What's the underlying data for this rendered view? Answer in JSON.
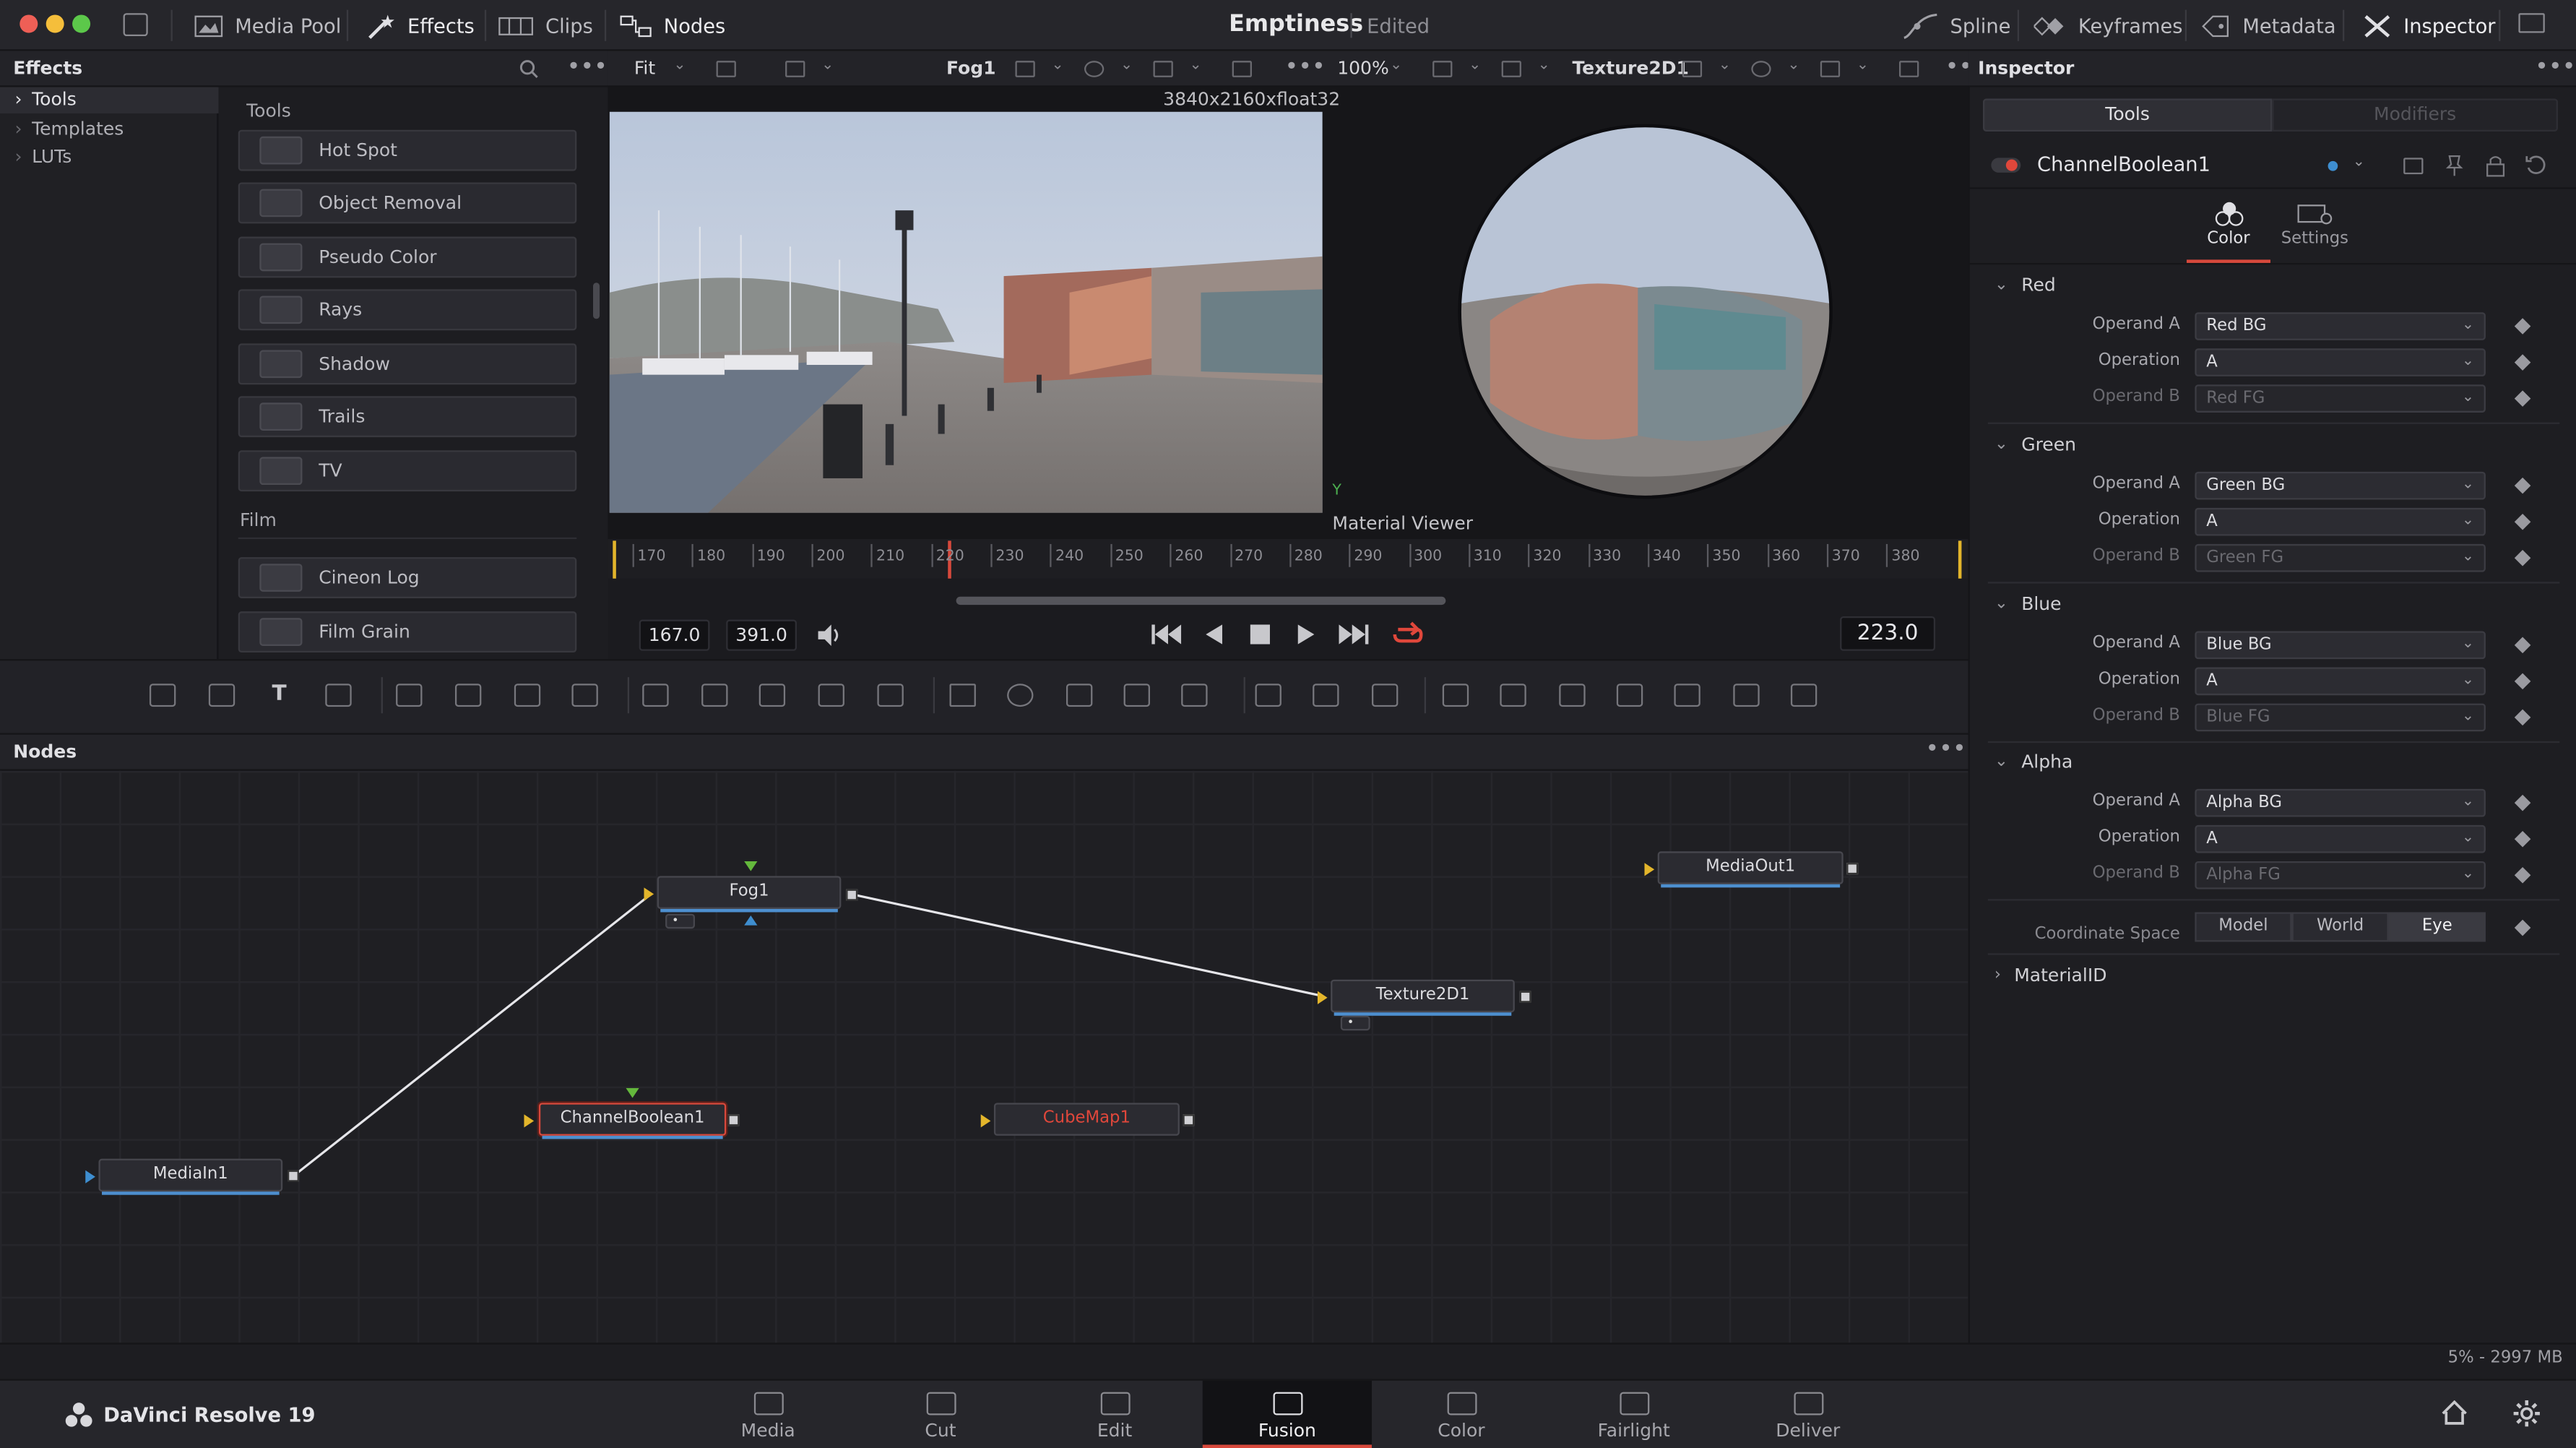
{
  "topbar": {
    "media_pool": "Media Pool",
    "effects": "Effects",
    "clips": "Clips",
    "nodes": "Nodes",
    "project": "Emptiness",
    "status": "Edited",
    "spline": "Spline",
    "keyframes": "Keyframes",
    "metadata": "Metadata",
    "inspector": "Inspector"
  },
  "effects_panel": {
    "title": "Effects",
    "tree": [
      {
        "label": "Tools"
      },
      {
        "label": "Templates"
      },
      {
        "label": "LUTs"
      }
    ],
    "section_tools": "Tools",
    "tools": [
      "Hot Spot",
      "Object Removal",
      "Pseudo Color",
      "Rays",
      "Shadow",
      "Trails",
      "TV"
    ],
    "section_film": "Film",
    "film_tools": [
      "Cineon Log",
      "Film Grain"
    ]
  },
  "viewer_left": {
    "fit": "Fit",
    "node": "Fog1",
    "resolution": "3840x2160xfloat32"
  },
  "viewer_right": {
    "zoom": "100%",
    "node": "Texture2D1",
    "caption": "Material Viewer",
    "axis_y": "Y"
  },
  "timeline": {
    "ticks": [
      "170",
      "180",
      "190",
      "200",
      "210",
      "220",
      "230",
      "240",
      "250",
      "260",
      "270",
      "280",
      "290",
      "300",
      "310",
      "320",
      "330",
      "340",
      "350",
      "360",
      "370",
      "380"
    ],
    "start": "167.0",
    "end": "391.0",
    "current": "223.0"
  },
  "nodes_panel": {
    "title": "Nodes",
    "nodes": {
      "fog": "Fog1",
      "mediaout": "MediaOut1",
      "texture": "Texture2D1",
      "channelboolean": "ChannelBoolean1",
      "cubemap": "CubeMap1",
      "mediain": "MediaIn1"
    },
    "memory": "5% - 2997 MB"
  },
  "inspector": {
    "title": "Inspector",
    "tab_tools": "Tools",
    "tab_modifiers": "Modifiers",
    "node_name": "ChannelBoolean1",
    "sub_color": "Color",
    "sub_settings": "Settings",
    "sections": [
      {
        "name": "Red",
        "operand_a": "Red   BG",
        "operation": "A",
        "operand_b": "Red   FG"
      },
      {
        "name": "Green",
        "operand_a": "Green BG",
        "operation": "A",
        "operand_b": "Green FG"
      },
      {
        "name": "Blue",
        "operand_a": "Blue   BG",
        "operation": "A",
        "operand_b": "Blue   FG"
      },
      {
        "name": "Alpha",
        "operand_a": "Alpha  BG",
        "operation": "A",
        "operand_b": "Alpha  FG"
      }
    ],
    "label_operand_a": "Operand A",
    "label_operation": "Operation",
    "label_operand_b": "Operand B",
    "coordinate_space_label": "Coordinate Space",
    "coordinate_space": [
      "Model",
      "World",
      "Eye"
    ],
    "material_id": "MaterialID"
  },
  "bottom": {
    "app_name": "DaVinci Resolve 19",
    "pages": [
      "Media",
      "Cut",
      "Edit",
      "Fusion",
      "Color",
      "Fairlight",
      "Deliver"
    ]
  },
  "colors": {
    "accent_red": "#d8493c",
    "node_underline": "#4d8fcf",
    "input_triangle": "#e3b52b",
    "error_node_text": "#e0473b"
  }
}
